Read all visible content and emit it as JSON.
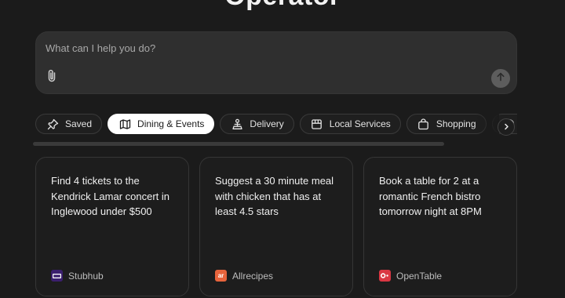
{
  "heading": {
    "title": "Operator"
  },
  "prompt": {
    "placeholder": "What can I help you do?",
    "attach_icon": "paperclip-icon",
    "send_icon": "arrow-up-icon"
  },
  "categories": [
    {
      "label": "Saved",
      "icon": "pin-icon",
      "active": false
    },
    {
      "label": "Dining & Events",
      "icon": "map-icon",
      "active": true
    },
    {
      "label": "Delivery",
      "icon": "person-delivery-icon",
      "active": false
    },
    {
      "label": "Local Services",
      "icon": "storefront-icon",
      "active": false
    },
    {
      "label": "Shopping",
      "icon": "shopping-bag-icon",
      "active": false
    },
    {
      "label": "",
      "icon": "basketball-icon",
      "active": false
    }
  ],
  "next_icon": "chevron-right-icon",
  "cards": [
    {
      "text": "Find 4 tickets to the Kendrick Lamar concert in Inglewood under $500",
      "source": "Stubhub",
      "logo_color": "#3b1f6e"
    },
    {
      "text": "Suggest a 30 minute meal with chicken that has at least 4.5 stars",
      "source": "Allrecipes",
      "logo_color": "#e8643c",
      "logo_text": "ar"
    },
    {
      "text": "Book a table for 2 at a romantic French bistro tomorrow night at 8PM",
      "source": "OpenTable",
      "logo_color": "#da3743"
    }
  ]
}
